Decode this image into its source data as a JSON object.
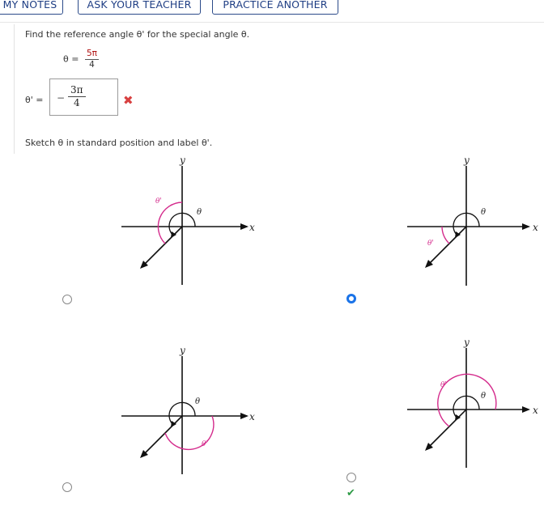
{
  "toolbar": {
    "my_notes": "MY NOTES",
    "ask_teacher": "ASK YOUR TEACHER",
    "practice_another": "PRACTICE ANOTHER"
  },
  "question": {
    "prompt": "Find the reference angle θ' for the special angle θ.",
    "given_label": "θ =",
    "given_num": "5π",
    "given_den": "4",
    "answer_label": "θ' =",
    "answer_sign": "−",
    "answer_num": "3π",
    "answer_den": "4",
    "answer_status_icon": "x-mark-icon",
    "sketch_prompt": "Sketch θ in standard position and label θ'."
  },
  "graph_labels": {
    "x": "x",
    "y": "y",
    "theta": "θ",
    "theta_prime": "θ'"
  },
  "options": [
    {
      "id": "A",
      "selected": false,
      "correct": false
    },
    {
      "id": "B",
      "selected": true,
      "correct": false
    },
    {
      "id": "C",
      "selected": false,
      "correct": false
    },
    {
      "id": "D",
      "selected": false,
      "correct": true
    }
  ],
  "colors": {
    "accent": "#1a73e8",
    "button_text": "#1f3e84",
    "reference_arc": "#d42b8c",
    "wrong": "#d84040",
    "correct": "#2e9b47"
  }
}
